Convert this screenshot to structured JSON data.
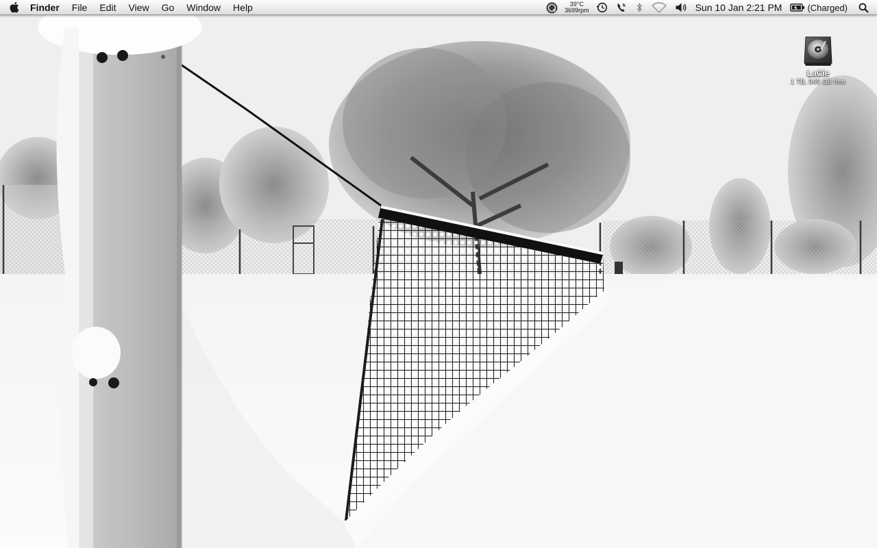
{
  "menubar": {
    "apple_icon": "apple-icon",
    "app_name": "Finder",
    "menus": [
      "File",
      "Edit",
      "View",
      "Go",
      "Window",
      "Help"
    ],
    "status": {
      "temperature": "39°C",
      "fan_speed": "3699rpm",
      "date_time": "Sun 10 Jan  2:21 PM",
      "battery_status": "(Charged)",
      "icons": [
        "system-monitor-icon",
        "time-machine-icon",
        "phone-icon",
        "bluetooth-icon",
        "wifi-icon",
        "volume-icon",
        "battery-icon",
        "spotlight-icon"
      ]
    }
  },
  "desktop": {
    "wallpaper": "snowy-tennis-court",
    "icons": [
      {
        "name": "LaCie",
        "info": "1 TB, 949 GB free",
        "icon": "external-drive-icon"
      }
    ]
  }
}
